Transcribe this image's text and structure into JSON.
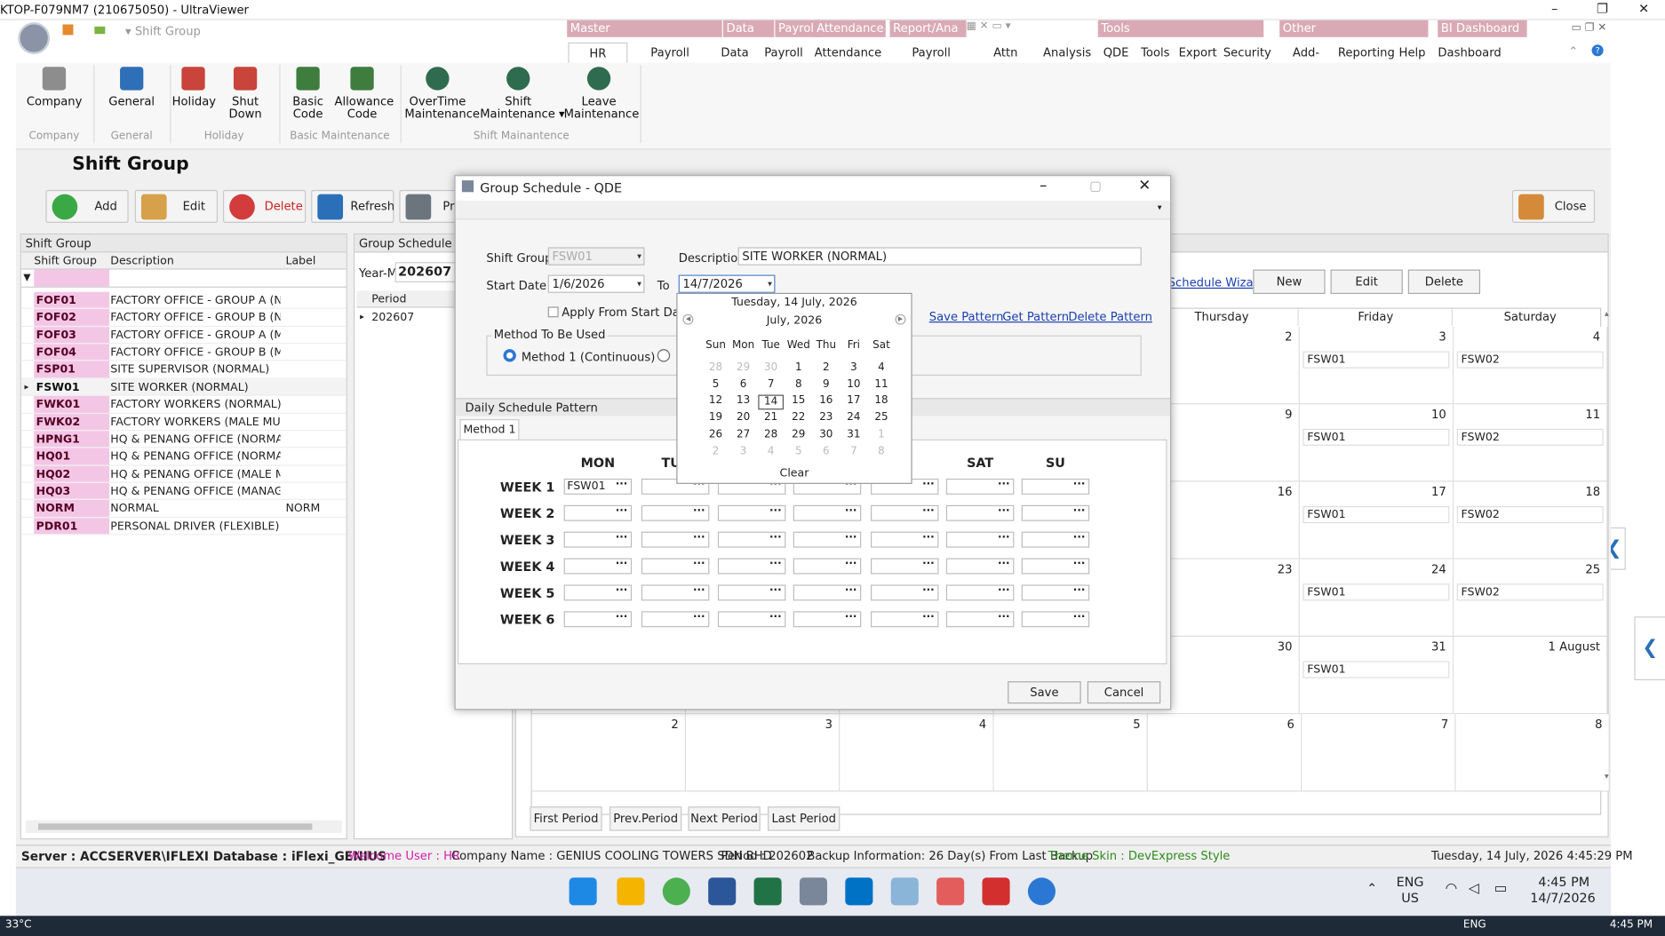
{
  "window": {
    "title": "KTOP-F079NM7 (210675050) - UltraViewer",
    "controls": [
      "–",
      "❐",
      "✕"
    ]
  },
  "ribbon": {
    "qat_label": "Shift Group",
    "groups": [
      "Master",
      "Data",
      "Payroll",
      "Attendance",
      "Report/Ana",
      "Tools",
      "Other",
      "BI Dashboard"
    ],
    "tabs": [
      "HR Master",
      "Payroll Master",
      "Data",
      "Payroll",
      "Attendance",
      "Payroll Report",
      "Attn Report",
      "Analysis",
      "QDE",
      "Tools",
      "Export",
      "Security",
      "Add-Ons",
      "Reporting",
      "Help",
      "Dashboard"
    ],
    "buttons": [
      "Company",
      "General",
      "Holiday",
      "Shut Down",
      "Basic\nCode",
      "Allowance\nCode",
      "OverTime\nMaintenance",
      "Shift\nMaintenance ▾",
      "Leave\nMaintenance"
    ],
    "group_labels": [
      "Company",
      "General",
      "Holiday",
      "Basic Maintenance",
      "Shift Mainantence"
    ]
  },
  "page": {
    "title": "Shift Group",
    "toolbar": {
      "add": "Add",
      "edit": "Edit",
      "delete": "Delete",
      "refresh": "Refresh",
      "print": "Pr",
      "close": "Close"
    }
  },
  "shift_group": {
    "header": "Shift Group",
    "columns": [
      "Shift Group",
      "Description",
      "Label"
    ],
    "rows": [
      {
        "code": "FOF01",
        "desc": "FACTORY OFFICE - GROUP A (NO...",
        "label": ""
      },
      {
        "code": "FOF02",
        "desc": "FACTORY OFFICE - GROUP B (NO...",
        "label": ""
      },
      {
        "code": "FOF03",
        "desc": "FACTORY OFFICE - GROUP A (M...",
        "label": ""
      },
      {
        "code": "FOF04",
        "desc": "FACTORY OFFICE - GROUP B (MA...",
        "label": ""
      },
      {
        "code": "FSP01",
        "desc": "SITE SUPERVISOR (NORMAL)",
        "label": ""
      },
      {
        "code": "FSW01",
        "desc": "SITE WORKER (NORMAL)",
        "label": ""
      },
      {
        "code": "FWK01",
        "desc": "FACTORY WORKERS (NORMAL)",
        "label": ""
      },
      {
        "code": "FWK02",
        "desc": "FACTORY WORKERS (MALE MUS...",
        "label": ""
      },
      {
        "code": "HPNG1",
        "desc": "HQ & PENANG OFFICE (NORMAL)",
        "label": ""
      },
      {
        "code": "HQ01",
        "desc": "HQ & PENANG OFFICE (NORMAL)",
        "label": ""
      },
      {
        "code": "HQ02",
        "desc": "HQ & PENANG OFFICE (MALE MU...",
        "label": ""
      },
      {
        "code": "HQ03",
        "desc": "HQ & PENANG OFFICE (MANAGE...",
        "label": ""
      },
      {
        "code": "NORM",
        "desc": "NORMAL",
        "label": "NORM"
      },
      {
        "code": "PDR01",
        "desc": "PERSONAL DRIVER (FLEXIBLE)",
        "label": ""
      }
    ]
  },
  "group_schedule": {
    "header": "Group Schedule",
    "year_label": "Year-M",
    "year_value": "202607",
    "period_col": "Period",
    "period_row": "202607",
    "wizard_link": "Schedule Wizard",
    "btn_new": "New",
    "btn_edit": "Edit",
    "btn_delete": "Delete",
    "days": [
      "Thursday",
      "Friday",
      "Saturday"
    ],
    "nav": [
      "First Period",
      "Prev.Period",
      "Next Period",
      "Last Period"
    ]
  },
  "calendar_rows": [
    {
      "nums": [
        "2",
        "3",
        "4"
      ],
      "shifts": [
        "",
        "FSW01",
        "FSW02"
      ]
    },
    {
      "nums": [
        "9",
        "10",
        "11"
      ],
      "shifts": [
        "",
        "FSW01",
        "FSW02"
      ]
    },
    {
      "nums": [
        "16",
        "17",
        "18"
      ],
      "shifts": [
        "",
        "FSW01",
        "FSW02"
      ]
    },
    {
      "nums": [
        "23",
        "24",
        "25"
      ],
      "shifts": [
        "",
        "FSW01",
        "FSW02"
      ]
    },
    {
      "nums": [
        "30",
        "31",
        "1 August"
      ],
      "shifts": [
        "",
        "FSW01",
        ""
      ]
    }
  ],
  "calendar_last_row": [
    "2",
    "3",
    "4",
    "5",
    "6",
    "7",
    "8"
  ],
  "status": {
    "server": "Server : ACCSERVER\\IFLEXI Database : iFlexi_GENIUS",
    "user": "Welcome User : HR",
    "company": "Company Name : GENIUS COOLING TOWERS SDN BHD",
    "period": "Period : 202602",
    "backup": "Backup Information: 26 Day(s) From Last Backup",
    "theme": "Theme Skin : DevExpress Style",
    "datetime": "Tuesday, 14 July, 2026 4:45:29 PM"
  },
  "taskbar": {
    "lang1": "ENG",
    "lang2": "US",
    "time": "4:45 PM",
    "date": "14/7/2026",
    "temp": "33°C",
    "bottom_lang": "ENG",
    "bottom_time": "4:45 PM"
  },
  "dialog": {
    "title": "Group Schedule - QDE",
    "shift_group_label": "Shift Group",
    "shift_group_value": "FSW01",
    "description_label": "Description",
    "description_value": "SITE WORKER (NORMAL)",
    "start_label": "Start Date",
    "start_value": "1/6/2026",
    "to_label": "To",
    "to_value": "14/7/2026",
    "apply_label": "Apply From Start Date to",
    "method_group": "Method To Be Used",
    "method1": "Method 1 (Continuous)",
    "save_pattern": "Save Pattern",
    "get_pattern": "Get Pattern",
    "delete_pattern": "Delete Pattern",
    "daily_pattern": "Daily Schedule Pattern",
    "tab": "Method 1",
    "columns": [
      "MON",
      "TUE",
      "",
      "",
      "",
      "SAT",
      "SU"
    ],
    "weeks": [
      "WEEK 1",
      "WEEK 2",
      "WEEK 3",
      "WEEK 4",
      "WEEK 5",
      "WEEK 6"
    ],
    "week1_mon": "FSW01",
    "save": "Save",
    "cancel": "Cancel"
  },
  "popup": {
    "today": "Tuesday, 14 July, 2026",
    "month": "July, 2026",
    "dow": [
      "Sun",
      "Mon",
      "Tue",
      "Wed",
      "Thu",
      "Fri",
      "Sat"
    ],
    "weeks": [
      [
        "28",
        "29",
        "30",
        "1",
        "2",
        "3",
        "4"
      ],
      [
        "5",
        "6",
        "7",
        "8",
        "9",
        "10",
        "11"
      ],
      [
        "12",
        "13",
        "14",
        "15",
        "16",
        "17",
        "18"
      ],
      [
        "19",
        "20",
        "21",
        "22",
        "23",
        "24",
        "25"
      ],
      [
        "26",
        "27",
        "28",
        "29",
        "30",
        "31",
        "1"
      ],
      [
        "2",
        "3",
        "4",
        "5",
        "6",
        "7",
        "8"
      ]
    ],
    "clear": "Clear"
  },
  "colors": {
    "accent": "#f4c6e6",
    "link": "#1a3fb0",
    "brand_tab": "#d9aab6",
    "user": "#d21ea8",
    "theme": "#2a8c1a"
  }
}
